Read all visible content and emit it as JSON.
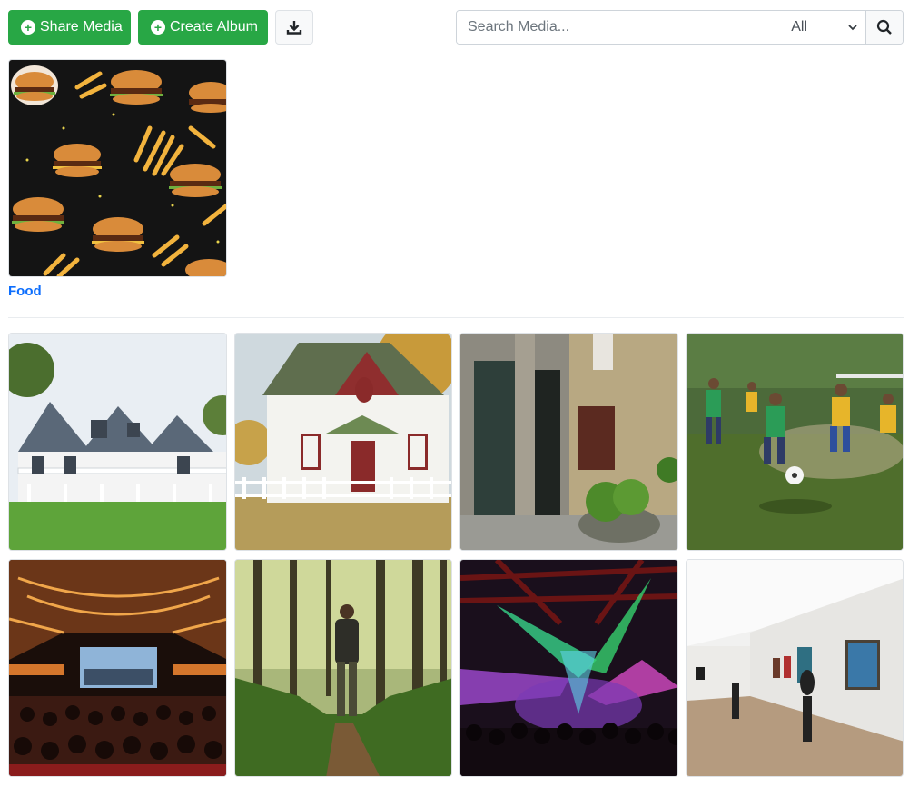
{
  "toolbar": {
    "share_label": "Share Media",
    "album_label": "Create Album",
    "download_icon": "download-icon"
  },
  "search": {
    "placeholder": "Search Media...",
    "filter_selected": "All",
    "search_icon": "search-icon"
  },
  "albums": [
    {
      "title": "Food",
      "thumbnail": "burgers-and-fries-pattern"
    }
  ],
  "media": [
    {
      "thumbnail": "white-victorian-house-with-porch"
    },
    {
      "thumbnail": "white-cottage-in-autumn"
    },
    {
      "thumbnail": "stone-building-with-doors"
    },
    {
      "thumbnail": "soccer-players-on-field"
    },
    {
      "thumbnail": "theater-audience-and-screen"
    },
    {
      "thumbnail": "hiker-on-forest-trail"
    },
    {
      "thumbnail": "concert-with-colored-lights"
    },
    {
      "thumbnail": "art-gallery-with-sculptures"
    }
  ]
}
